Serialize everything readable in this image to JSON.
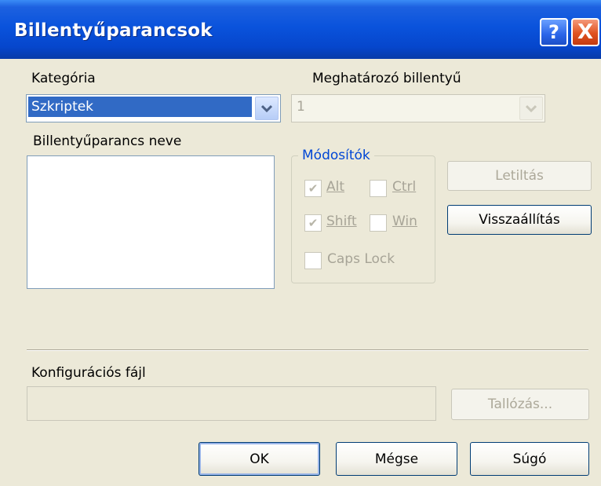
{
  "window": {
    "title": "Billentyűparancsok",
    "help_glyph": "?",
    "close_glyph": "X"
  },
  "kategoria": {
    "label": "Kategória",
    "selected": "Szkriptek"
  },
  "meghatarozo": {
    "label": "Meghatározó billentyű",
    "selected": "1"
  },
  "parancs": {
    "label": "Billentyűparancs neve",
    "items": []
  },
  "modositok": {
    "legend": "Módosítók",
    "alt": {
      "label": "Alt",
      "checked": true
    },
    "ctrl": {
      "label": "Ctrl",
      "checked": false
    },
    "shift": {
      "label": "Shift",
      "checked": true
    },
    "win": {
      "label": "Win",
      "checked": false
    },
    "capslock": {
      "label": "Caps Lock",
      "checked": false
    }
  },
  "buttons": {
    "letiltas": "Letiltás",
    "visszaallitas": "Visszaállítás",
    "tallozas": "Tallózás...",
    "ok": "OK",
    "megse": "Mégse",
    "sugo": "Súgó"
  },
  "konfig": {
    "label": "Konfigurációs fájl",
    "value": ""
  },
  "icons": {
    "dropdown": "chevron-down-icon",
    "check": "checkmark-icon",
    "help": "help-icon",
    "close": "close-icon"
  }
}
